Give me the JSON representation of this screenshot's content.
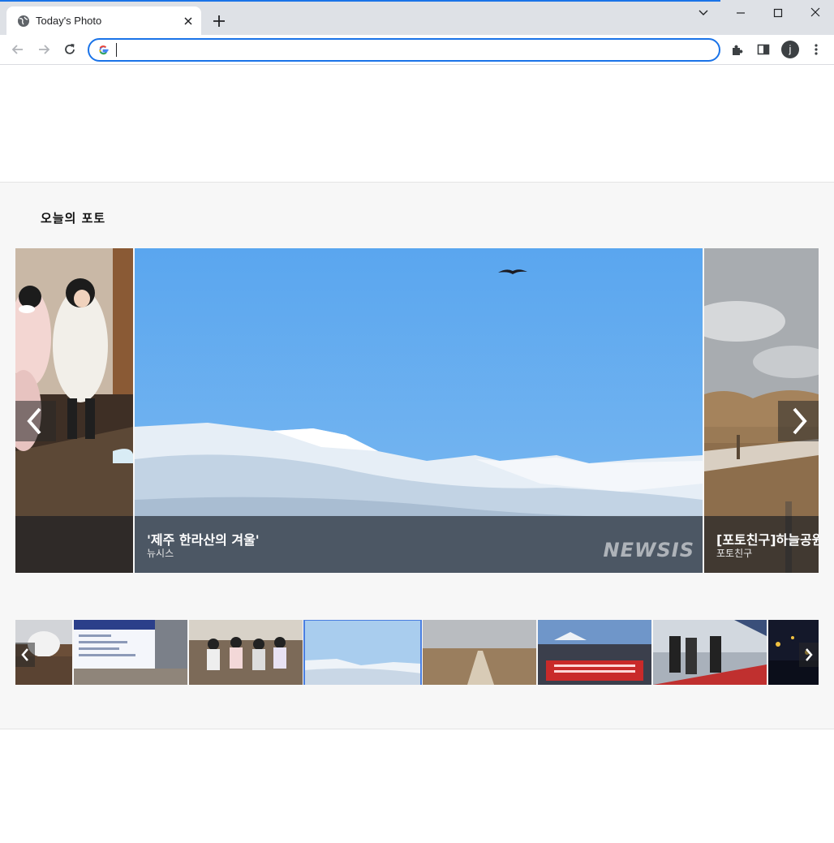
{
  "browser": {
    "tab_title": "Today's Photo",
    "avatar_letter": "j"
  },
  "section": {
    "title": "오늘의 포토"
  },
  "slides": [
    {
      "title": "",
      "source": ""
    },
    {
      "title": "'제주 한라산의 겨울'",
      "source": "뉴시스",
      "watermark": "NEWSIS"
    },
    {
      "title": "[포토친구]하늘공원",
      "source": "포토친구"
    }
  ],
  "thumbnails": [
    {
      "subject": "children-in-hallway"
    },
    {
      "subject": "train-ticket-board"
    },
    {
      "subject": "children-waving"
    },
    {
      "subject": "hallasan-winter",
      "active": true
    },
    {
      "subject": "field-path"
    },
    {
      "subject": "press-conference"
    },
    {
      "subject": "officials-red-carpet"
    },
    {
      "subject": "night-crowd"
    }
  ],
  "colors": {
    "accent": "#1a73e8",
    "sky": "#5ca9f0",
    "section_bg": "#f7f7f7"
  }
}
